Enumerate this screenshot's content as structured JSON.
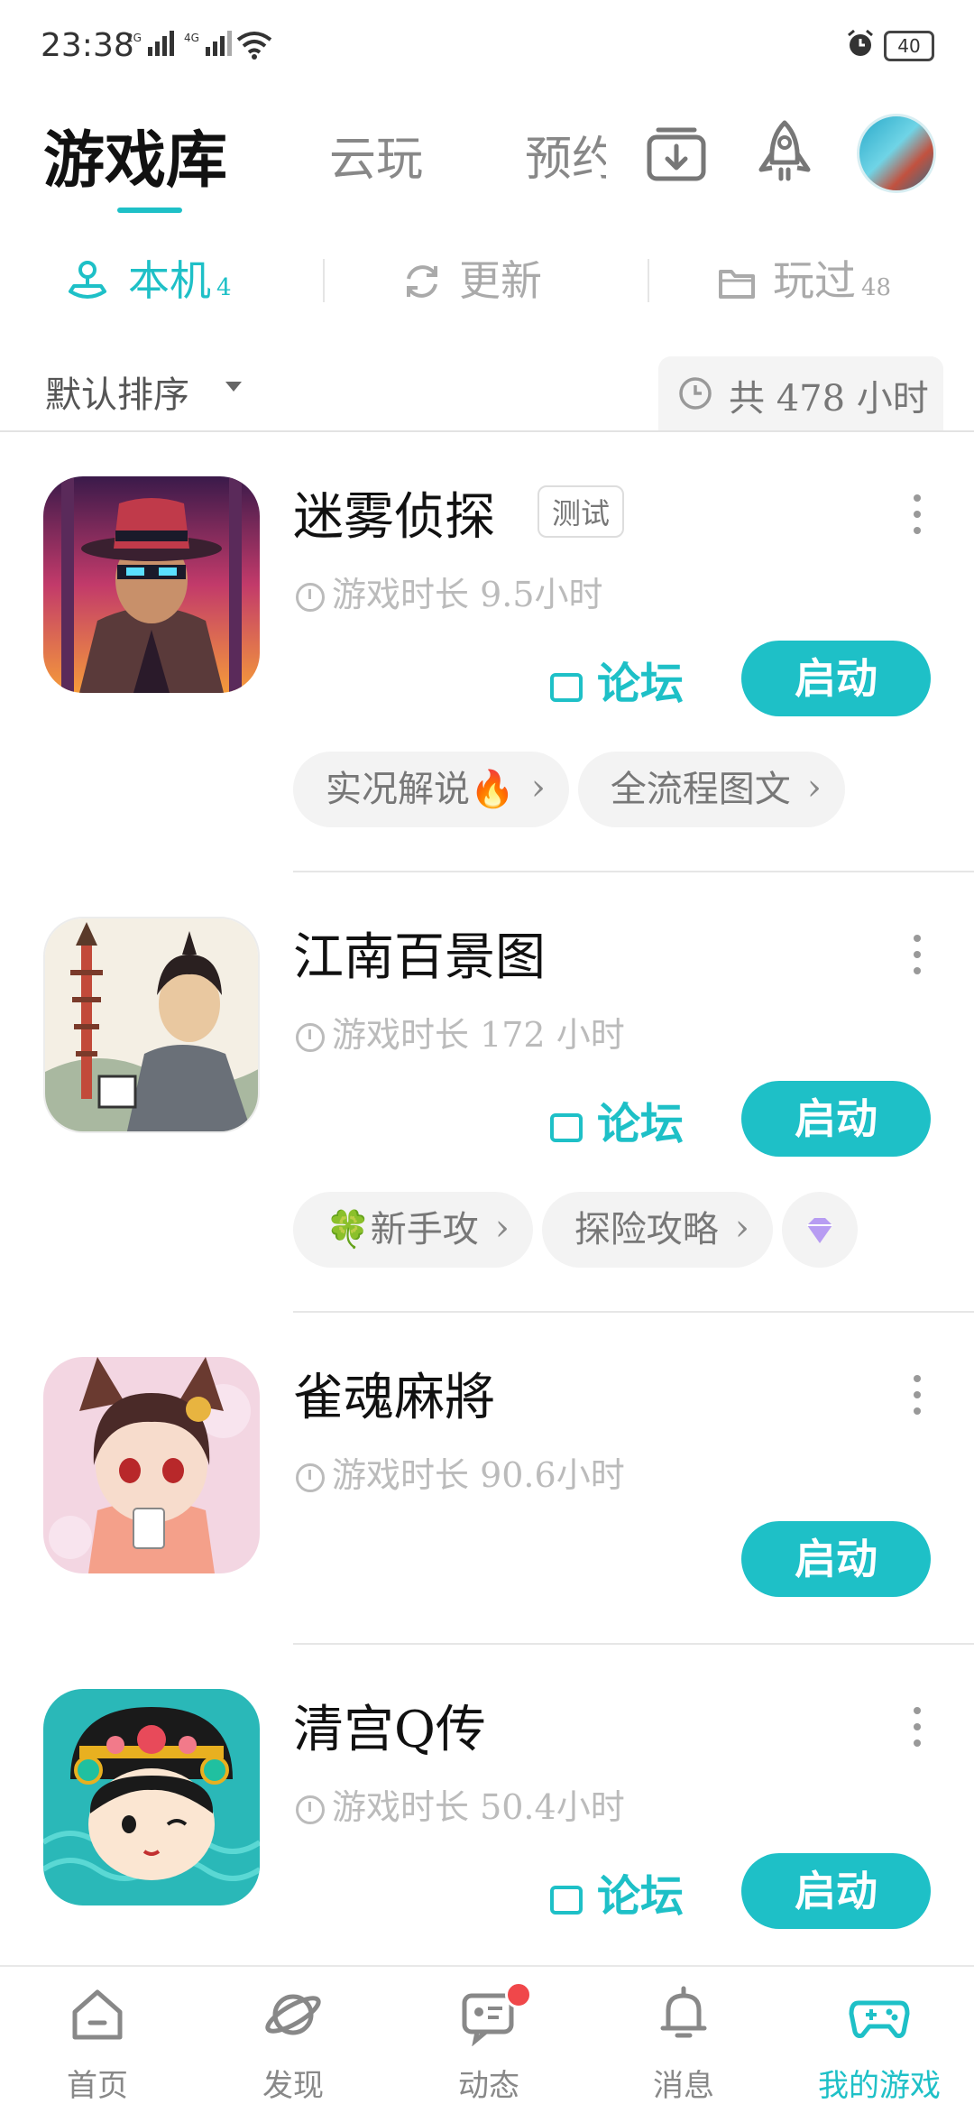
{
  "status_bar": {
    "time": "23:38",
    "signal_1": "2G",
    "signal_2": "4G",
    "battery": "40"
  },
  "top_tabs": {
    "library": "游戏库",
    "cloud": "云玩",
    "preorder": "预约"
  },
  "sub_tabs": {
    "local": {
      "label": "本机",
      "count": "4"
    },
    "update": {
      "label": "更新"
    },
    "played": {
      "label": "玩过",
      "count": "48"
    }
  },
  "sort": {
    "label": "默认排序",
    "total_label": "共 478 小时"
  },
  "games": [
    {
      "title": "迷雾侦探",
      "badge": "测试",
      "playtime": "游戏时长 9.5小时",
      "forum": "论坛",
      "launch": "启动",
      "chips": [
        "实况解说🔥",
        "全流程图文"
      ]
    },
    {
      "title": "江南百景图",
      "playtime": "游戏时长 172 小时",
      "forum": "论坛",
      "launch": "启动",
      "chips": [
        "🍀新手攻",
        "探险攻略"
      ]
    },
    {
      "title": "雀魂麻將",
      "playtime": "游戏时长 90.6小时",
      "launch": "启动"
    },
    {
      "title": "清宫Q传",
      "playtime": "游戏时长 50.4小时",
      "forum": "论坛",
      "launch": "启动"
    }
  ],
  "bottom_nav": {
    "home": "首页",
    "discover": "发现",
    "feed": "动态",
    "messages": "消息",
    "my_games": "我的游戏"
  },
  "colors": {
    "accent": "#1ec0c7",
    "notification": "#f0474a"
  }
}
